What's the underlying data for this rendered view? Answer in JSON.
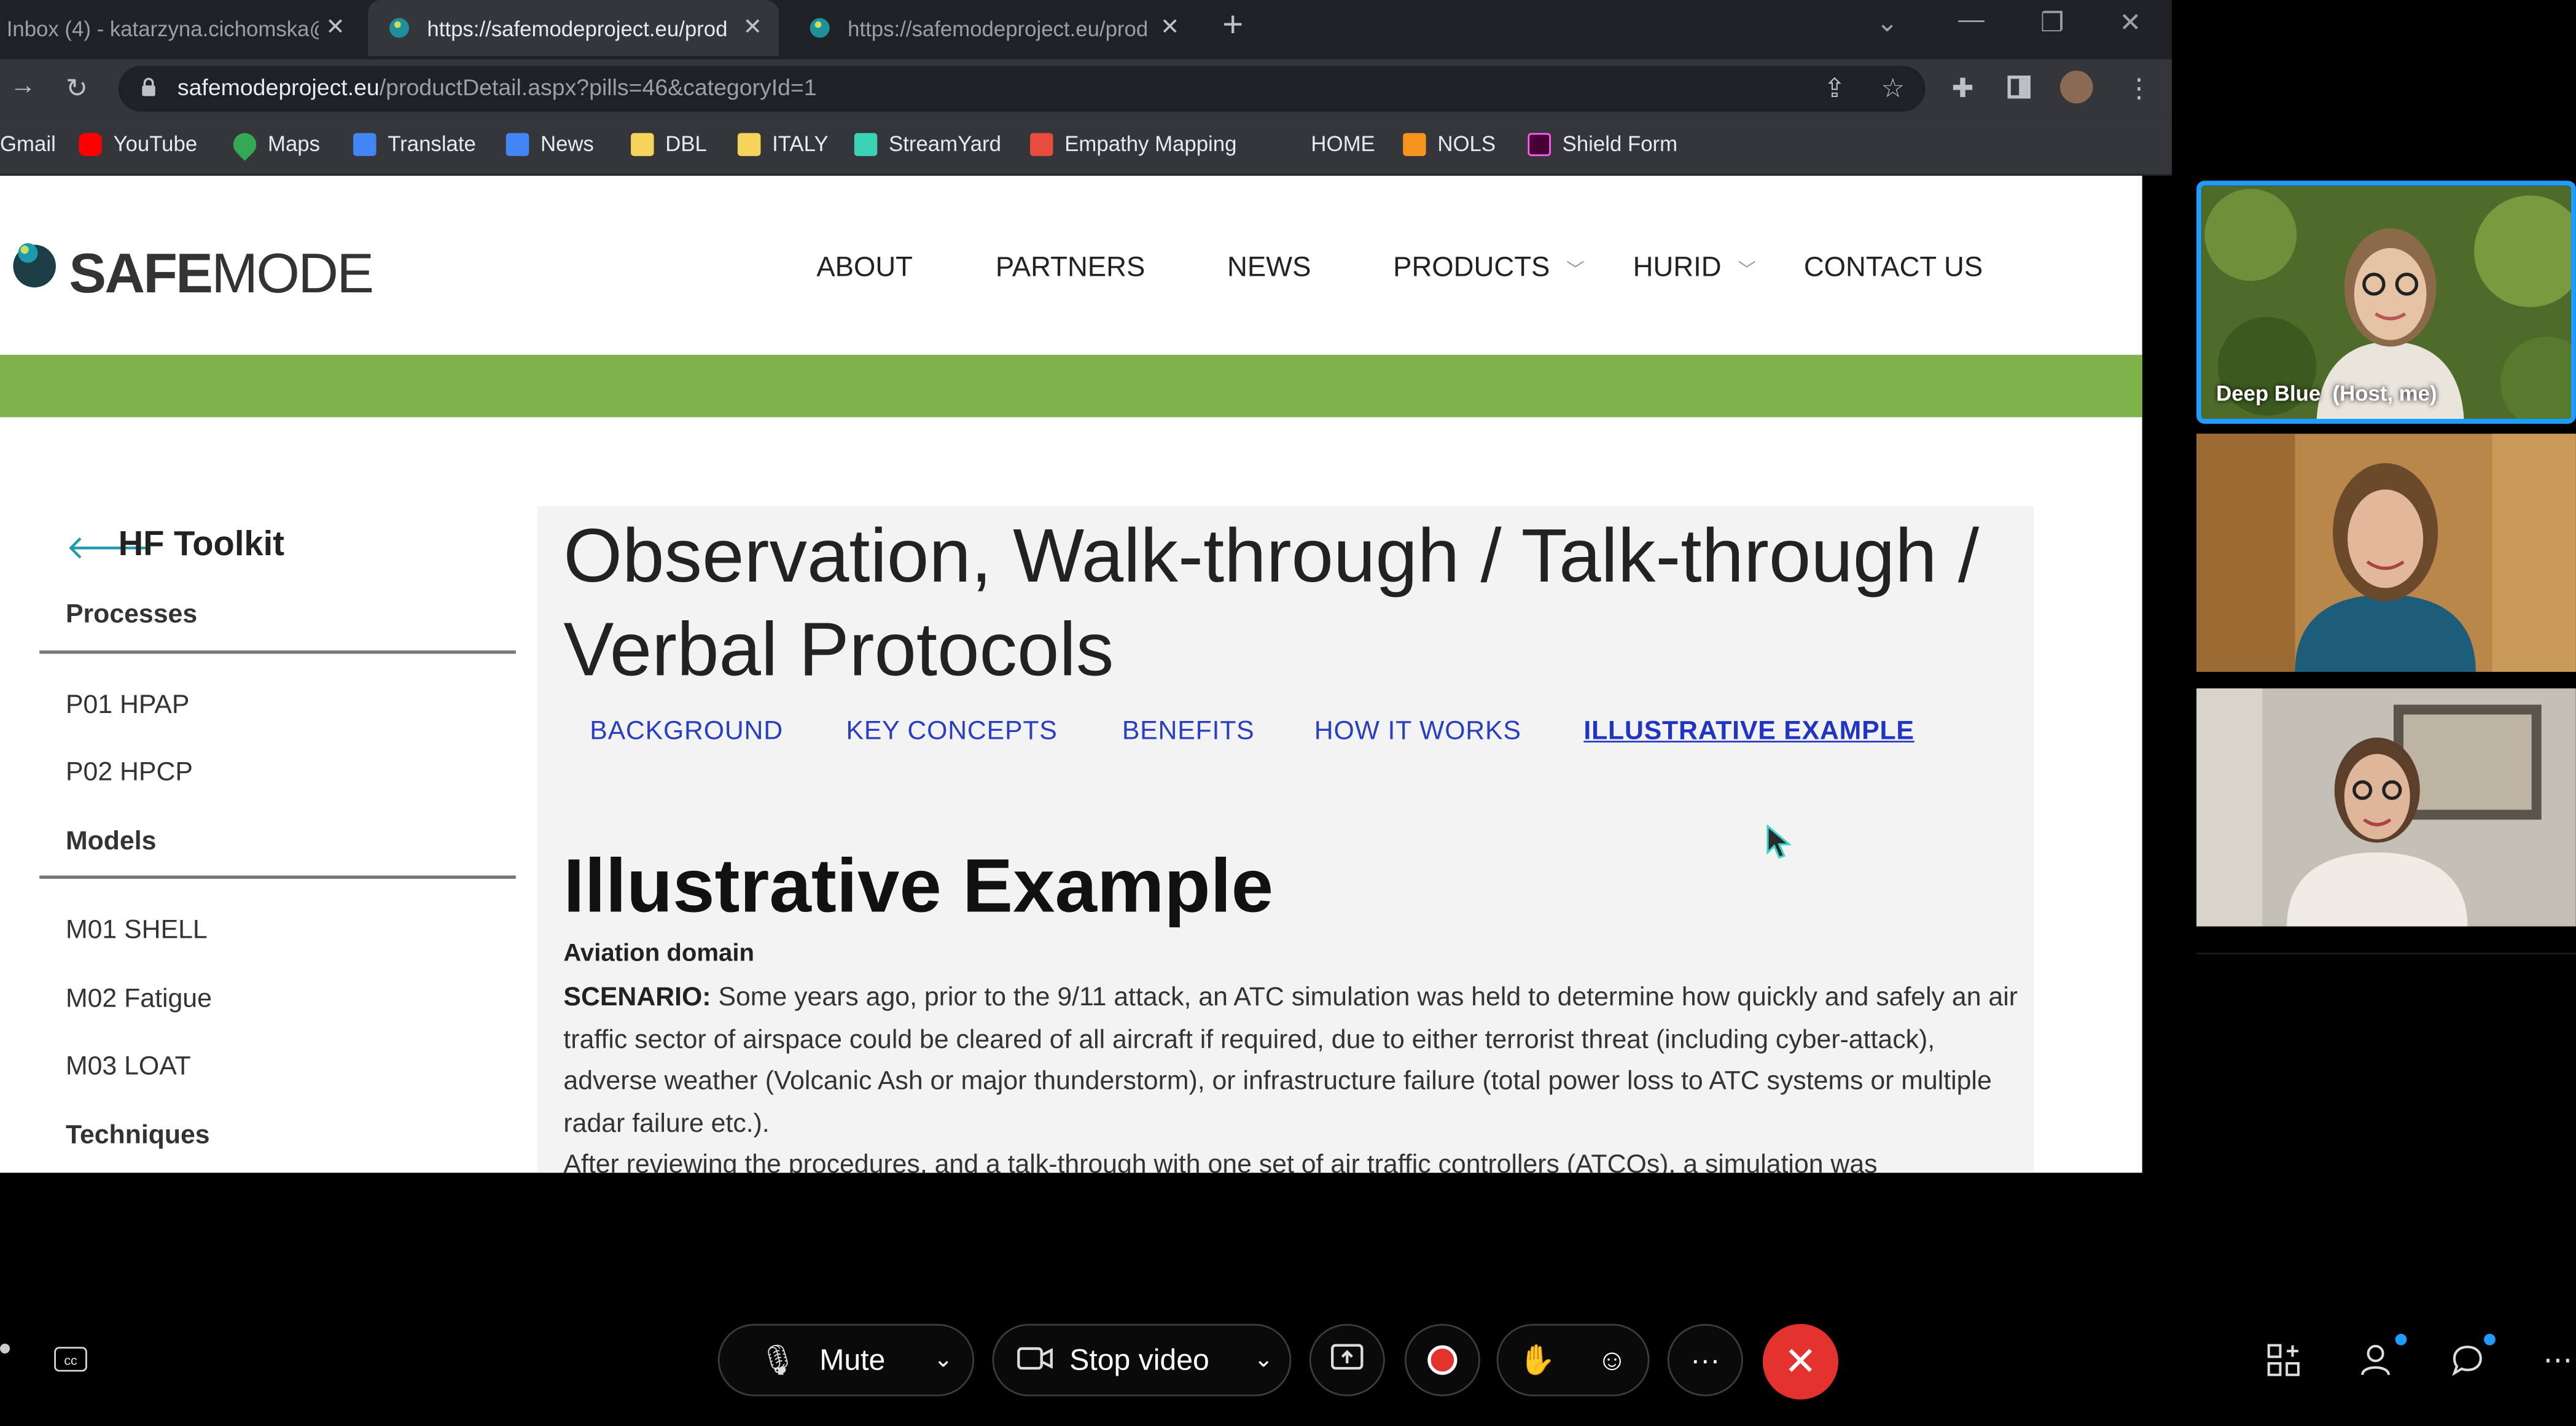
{
  "browser": {
    "tabs": [
      {
        "title": "Inbox (4) - katarzyna.cichomska@",
        "active": false
      },
      {
        "title": "https://safemodeproject.eu/prod",
        "active": true
      },
      {
        "title": "https://safemodeproject.eu/prod",
        "active": false
      }
    ],
    "url_domain": "safemodeproject.eu",
    "url_path": "/productDetail.aspx?pills=46&categoryId=1",
    "bookmarks": [
      {
        "label": "Gmail",
        "icon": "gmail-icon"
      },
      {
        "label": "YouTube",
        "icon": "youtube-icon",
        "color": "#ff0000"
      },
      {
        "label": "Maps",
        "icon": "maps-icon",
        "color": "#34a853"
      },
      {
        "label": "Translate",
        "icon": "translate-icon",
        "color": "#4285f4"
      },
      {
        "label": "News",
        "icon": "news-icon",
        "color": "#4285f4"
      },
      {
        "label": "DBL",
        "icon": "folder-icon",
        "color": "#f6d35a"
      },
      {
        "label": "ITALY",
        "icon": "folder-icon",
        "color": "#f6d35a"
      },
      {
        "label": "StreamYard",
        "icon": "streamyard-icon",
        "color": "#3ad3b6"
      },
      {
        "label": "Empathy Mapping",
        "icon": "empathy-icon",
        "color": "#e74c3c"
      },
      {
        "label": "HOME",
        "icon": "none"
      },
      {
        "label": "NOLS",
        "icon": "nols-icon",
        "color": "#f7941d"
      },
      {
        "label": "Shield Form",
        "icon": "xd-icon",
        "color": "#ff61f6"
      }
    ]
  },
  "site": {
    "logo_safe": "SAFE",
    "logo_mode": "MODE",
    "nav": [
      {
        "label": "ABOUT",
        "dropdown": false
      },
      {
        "label": "PARTNERS",
        "dropdown": false
      },
      {
        "label": "NEWS",
        "dropdown": false
      },
      {
        "label": "PRODUCTS",
        "dropdown": true
      },
      {
        "label": "HURID",
        "dropdown": true
      },
      {
        "label": "CONTACT US",
        "dropdown": false
      }
    ],
    "sidebar": {
      "title": "HF Toolkit",
      "sections": [
        {
          "heading": "Processes",
          "items": [
            "P01 HPAP",
            "P02 HPCP"
          ]
        },
        {
          "heading": "Models",
          "items": [
            "M01 SHELL",
            "M02 Fatigue",
            "M03 LOAT"
          ]
        },
        {
          "heading": "Techniques",
          "items": []
        }
      ]
    },
    "page_title": "Observation, Walk-through / Talk-through / Verbal Protocols",
    "tabs": [
      "BACKGROUND",
      "KEY CONCEPTS",
      "BENEFITS",
      "HOW IT WORKS",
      "ILLUSTRATIVE EXAMPLE"
    ],
    "active_tab": "ILLUSTRATIVE EXAMPLE",
    "section_heading": "Illustrative Example",
    "domain_label": "Aviation domain",
    "scenario_label": "SCENARIO:",
    "scenario_text": " Some years ago, prior to the 9/11 attack, an ATC simulation was held to determine how quickly and safely an air traffic sector of airspace could be cleared of all aircraft if required, due to either terrorist threat (including cyber-attack), adverse weather (Volcanic Ash or major thunderstorm), or infrastructure failure (total power loss to ATC systems or multiple radar failure etc.).",
    "next_paragraph": "After reviewing the procedures, and a talk-through with one set of air traffic controllers (ATCOs), a simulation was"
  },
  "meeting": {
    "participants": [
      {
        "name": "Deep Blue",
        "role": "(Host, me)",
        "host": true
      },
      {
        "name": "",
        "role": "",
        "host": false
      },
      {
        "name": "",
        "role": "",
        "host": false
      }
    ],
    "controls": {
      "mute_label": "Mute",
      "video_label": "Stop video",
      "more_label": "···"
    },
    "colors": {
      "accent": "#1f9dff",
      "end_call": "#e4322f",
      "record": "#e4322f",
      "site_green": "#7fb24a"
    }
  }
}
